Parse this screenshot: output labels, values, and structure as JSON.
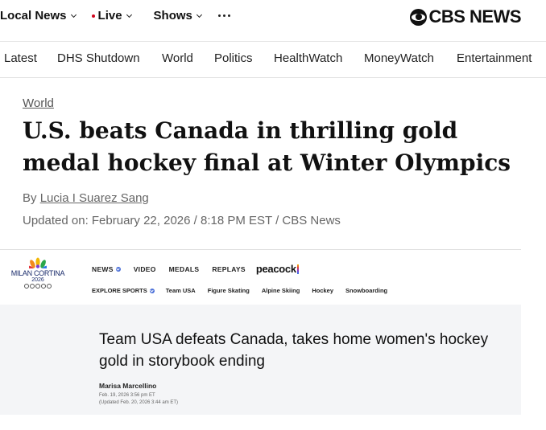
{
  "topnav": {
    "local_news": "Local News",
    "live": "Live",
    "shows": "Shows",
    "brand": "CBS NEWS"
  },
  "secnav": [
    "Latest",
    "DHS Shutdown",
    "World",
    "Politics",
    "HealthWatch",
    "MoneyWatch",
    "Entertainment"
  ],
  "article": {
    "kicker": "World",
    "headline": "U.S. beats Canada in thrilling gold medal hockey final at Winter Olympics",
    "by_prefix": "By ",
    "author": "Lucia I Suarez Sang",
    "updated": "Updated on: February 22, 2026 / 8:18 PM EST / CBS News"
  },
  "embed": {
    "logo_name": "MILAN CORTINA",
    "logo_year": "2026",
    "nav_primary": [
      "NEWS",
      "VIDEO",
      "MEDALS",
      "REPLAYS"
    ],
    "peacock": "peacock",
    "nav_explore": "EXPLORE SPORTS",
    "nav_secondary": [
      "Team USA",
      "Figure Skating",
      "Alpine Skiing",
      "Hockey",
      "Snowboarding"
    ],
    "title": "Team USA defeats Canada, takes home women's hockey gold in storybook ending",
    "author": "Marisa Marcellino",
    "date": "Feb. 19, 2026 3:56 pm ET",
    "updated": "(Updated Feb. 20, 2026 3:44 am ET)"
  },
  "colors": {
    "live_dot": "#d0021b",
    "mc_blue": "#1a2b6b",
    "embed_bg": "#f4f5f7"
  }
}
